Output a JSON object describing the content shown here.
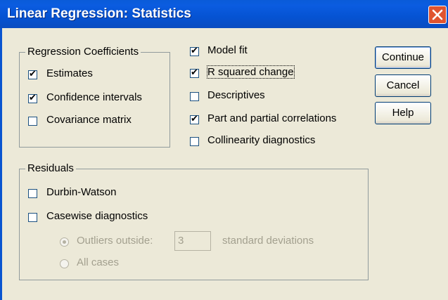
{
  "window": {
    "title": "Linear Regression: Statistics"
  },
  "regression_coefficients": {
    "legend": "Regression Coefficients",
    "items": [
      {
        "label": "Estimates",
        "checked": true
      },
      {
        "label": "Confidence intervals",
        "checked": true
      },
      {
        "label": "Covariance matrix",
        "checked": false
      }
    ]
  },
  "options": [
    {
      "label": "Model fit",
      "checked": true
    },
    {
      "label": "R squared change",
      "checked": true
    },
    {
      "label": "Descriptives",
      "checked": false
    },
    {
      "label": "Part and partial correlations",
      "checked": true
    },
    {
      "label": "Collinearity diagnostics",
      "checked": false
    }
  ],
  "residuals": {
    "legend": "Residuals",
    "durbin_watson": {
      "label": "Durbin-Watson",
      "checked": false
    },
    "casewise": {
      "label": "Casewise diagnostics",
      "checked": false
    },
    "outliers": {
      "label": "Outliers outside:",
      "selected": true,
      "value": "3",
      "suffix": "standard deviations"
    },
    "all_cases": {
      "label": "All cases",
      "selected": false
    }
  },
  "buttons": {
    "continue": "Continue",
    "cancel": "Cancel",
    "help": "Help"
  },
  "colors": {
    "title_bar": "#0553d3",
    "close_button": "#e0542f",
    "dialog_background": "#ece9d8"
  }
}
